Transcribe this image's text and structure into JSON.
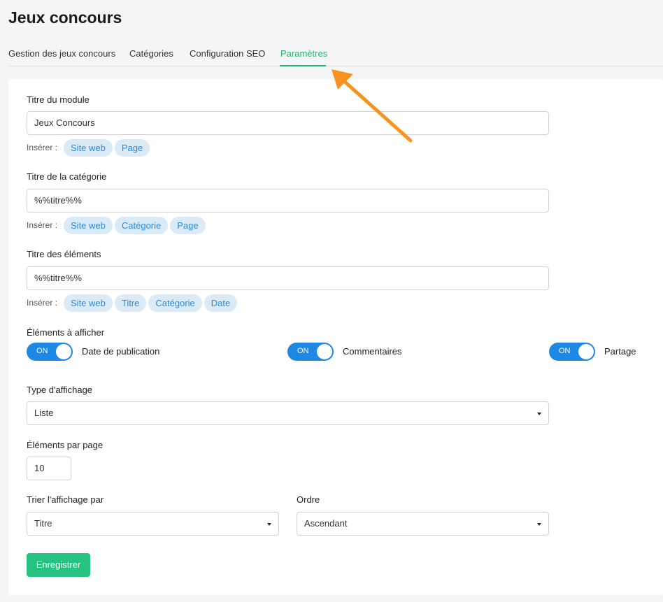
{
  "page_title": "Jeux concours",
  "tabs": [
    {
      "label": "Gestion des jeux concours"
    },
    {
      "label": "Catégories"
    },
    {
      "label": "Configuration SEO"
    },
    {
      "label": "Paramètres",
      "active": true
    }
  ],
  "form": {
    "module_title": {
      "label": "Titre du module",
      "value": "Jeux Concours",
      "insert_label": "Insérer :",
      "chips": [
        "Site web",
        "Page"
      ]
    },
    "category_title": {
      "label": "Titre de la catégorie",
      "value": "%%titre%%",
      "insert_label": "Insérer :",
      "chips": [
        "Site web",
        "Catégorie",
        "Page"
      ]
    },
    "element_title": {
      "label": "Titre des éléments",
      "value": "%%titre%%",
      "insert_label": "Insérer :",
      "chips": [
        "Site web",
        "Titre",
        "Catégorie",
        "Date"
      ]
    },
    "elements_to_show": {
      "label": "Éléments à afficher",
      "toggles": [
        {
          "state": "ON",
          "label": "Date de publication"
        },
        {
          "state": "ON",
          "label": "Commentaires"
        },
        {
          "state": "ON",
          "label": "Partage"
        }
      ]
    },
    "display_type": {
      "label": "Type d'affichage",
      "value": "Liste"
    },
    "per_page": {
      "label": "Éléments par page",
      "value": "10"
    },
    "sort_by": {
      "label": "Trier l'affichage par",
      "value": "Titre"
    },
    "order": {
      "label": "Ordre",
      "value": "Ascendant"
    },
    "save_label": "Enregistrer"
  },
  "colors": {
    "accent": "#21b571",
    "toggle": "#1e88e5",
    "chip_bg": "#dbeaf7",
    "chip_text": "#2a8cd8",
    "arrow": "#f7931e",
    "save": "#26c281"
  },
  "annotation": {
    "icon": "arrow-annotation-icon",
    "points_to": "Paramètres"
  }
}
